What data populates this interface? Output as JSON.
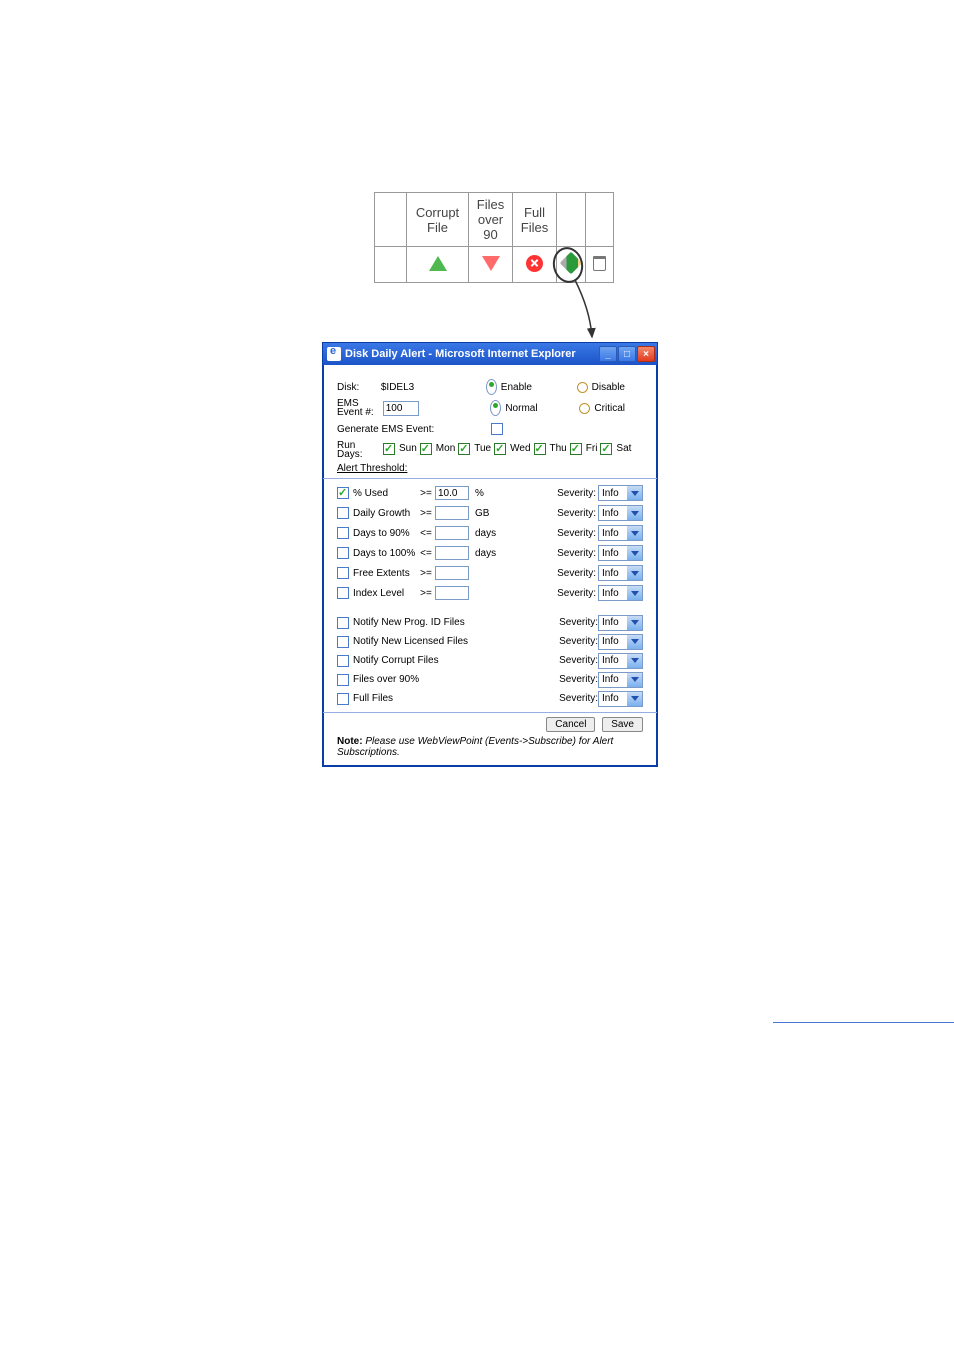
{
  "headerTable": {
    "cols": [
      "",
      "Corrupt File",
      "Files over 90",
      "Full Files",
      "",
      ""
    ],
    "icons": [
      "",
      "triangle-up-icon",
      "triangle-down-icon",
      "circled-x-icon",
      "pencil-icon",
      "trash-icon"
    ]
  },
  "window": {
    "title": "Disk Daily Alert - Microsoft Internet Explorer",
    "minimize": "_",
    "maximize": "□",
    "close": "×"
  },
  "form": {
    "disk_label": "Disk:",
    "disk_value": "$IDEL3",
    "enable": "Enable",
    "disable": "Disable",
    "ems_label": "EMS Event #:",
    "ems_value": "100",
    "normal": "Normal",
    "critical": "Critical",
    "gen_ems": "Generate EMS Event:",
    "run_days": "Run Days:",
    "days": [
      "Sun",
      "Mon",
      "Tue",
      "Wed",
      "Thu",
      "Fri",
      "Sat"
    ],
    "alert_threshold": "Alert Threshold:",
    "thresholds": [
      {
        "label": "% Used",
        "op": ">=",
        "val": "10.0",
        "unit": "%",
        "checked": true
      },
      {
        "label": "Daily Growth",
        "op": ">=",
        "val": "",
        "unit": "GB",
        "checked": false
      },
      {
        "label": "Days to 90%",
        "op": "<=",
        "val": "",
        "unit": "days",
        "checked": false
      },
      {
        "label": "Days to 100%",
        "op": "<=",
        "val": "",
        "unit": "days",
        "checked": false
      },
      {
        "label": "Free Extents",
        "op": ">=",
        "val": "",
        "unit": "",
        "checked": false
      },
      {
        "label": "Index Level",
        "op": ">=",
        "val": "",
        "unit": "",
        "checked": false
      }
    ],
    "notifies": [
      {
        "label": "Notify New Prog. ID Files"
      },
      {
        "label": "Notify New Licensed Files"
      },
      {
        "label": "Notify Corrupt Files"
      },
      {
        "label": "Files over 90%"
      },
      {
        "label": "Full Files"
      }
    ],
    "severity_label": "Severity:",
    "severity_value": "Info",
    "cancel": "Cancel",
    "save": "Save",
    "note_bold": "Note:",
    "note_text": " Please use WebViewPoint (Events->Subscribe) for Alert Subscriptions."
  }
}
